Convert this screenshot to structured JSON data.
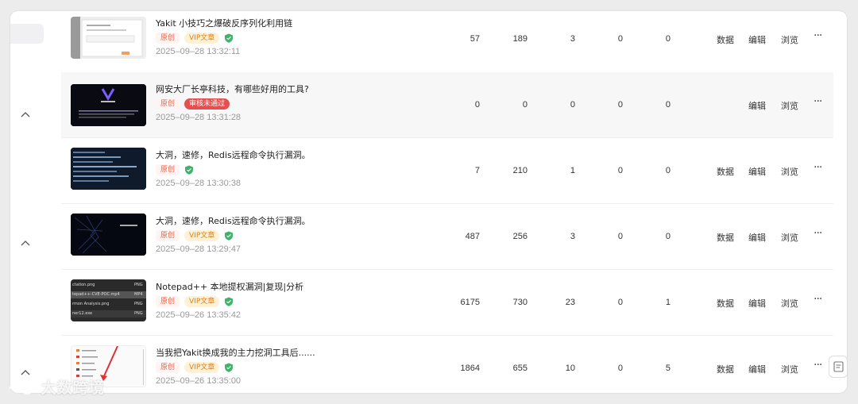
{
  "actions": {
    "data": "数据",
    "edit": "编辑",
    "browse": "浏览",
    "more": "···"
  },
  "tags": {
    "original": "原创",
    "vip": "VIP文章",
    "rejected": "审核未通过"
  },
  "rows": [
    {
      "title": "Yakit 小技巧之爆破反序列化利用链",
      "time": "2025–09–28 13:32:11",
      "n1": "57",
      "n2": "189",
      "n3": "3",
      "n4": "0",
      "n5": "0"
    },
    {
      "title": "网安大厂长亭科技，有哪些好用的工具?",
      "time": "2025–09–28 13:31:28",
      "n1": "0",
      "n2": "0",
      "n3": "0",
      "n4": "0",
      "n5": "0"
    },
    {
      "title": "大洞，速修，Redis远程命令执行漏洞。",
      "time": "2025–09–28 13:30:38",
      "n1": "7",
      "n2": "210",
      "n3": "1",
      "n4": "0",
      "n5": "0"
    },
    {
      "title": "大洞，速修，Redis远程命令执行漏洞。",
      "time": "2025–09–28 13:29:47",
      "n1": "487",
      "n2": "256",
      "n3": "3",
      "n4": "0",
      "n5": "0"
    },
    {
      "title": "Notepad++ 本地提权漏洞|复现|分析",
      "time": "2025–09–26 13:35:42",
      "n1": "6175",
      "n2": "730",
      "n3": "23",
      "n4": "0",
      "n5": "1"
    },
    {
      "title": "当我把Yakit换成我的主力挖洞工具后......",
      "time": "2025–09–26 13:35:00",
      "n1": "1864",
      "n2": "655",
      "n3": "10",
      "n4": "0",
      "n5": "5"
    }
  ],
  "thumb_texts": {
    "r5_lines": [
      "ctation.png",
      "tepad++-CVE-POC.mp4",
      "rmon Analysis.png",
      "ner12.exe"
    ],
    "r5_types": [
      "PNG",
      "MP4",
      "PNG",
      "PNG"
    ]
  },
  "watermark": "大数跨境",
  "colors": {
    "accent_orange": "#f4593d",
    "vip": "#e47f13",
    "reject": "#e54f4f",
    "shield": "#3fb26b"
  }
}
